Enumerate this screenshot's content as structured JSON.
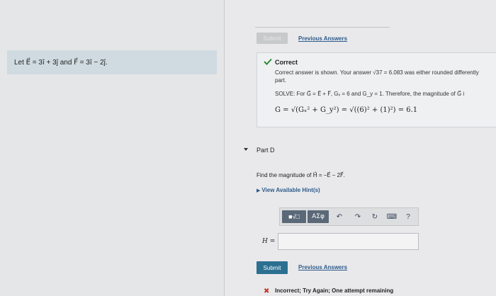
{
  "problem": {
    "text": "Let E⃗ = 3î + 3ĵ and F⃗ = 3î − 2ĵ."
  },
  "previous_part": {
    "submit_label": "Submit",
    "previous_answers_label": "Previous Answers",
    "feedback_title": "Correct",
    "feedback_message": "Correct answer is shown. Your answer √37 = 6.083 was either rounded differently",
    "feedback_message_2": "part.",
    "solve_text": "SOLVE: For G⃗ = E⃗ + F⃗, Gₓ = 6 and G_y = 1. Therefore, the magnitude of G⃗ i",
    "formula": "G = √(Gₓ² + G_y²) = √((6)² + (1)²) = 6.1"
  },
  "part_d": {
    "title": "Part D",
    "question": "Find the magnitude of H⃗ = −E⃗ − 2F⃗.",
    "hint_label": "View Available Hint(s)",
    "toolbar": {
      "templates_label": "■√□",
      "symbols_label": "ΑΣφ",
      "undo_glyph": "↶",
      "redo_glyph": "↷",
      "reset_glyph": "↻",
      "keyboard_glyph": "⌨",
      "help_glyph": "?"
    },
    "answer_label": "H =",
    "answer_value": "",
    "submit_label": "Submit",
    "previous_answers_label": "Previous Answers",
    "feedback_mark": "✖",
    "feedback_text": "Incorrect; Try Again; One attempt remaining"
  },
  "colors": {
    "accent": "#2b7090",
    "link": "#2c5a8a",
    "correct_green": "#2f8a3a",
    "incorrect_red": "#c0392b"
  }
}
